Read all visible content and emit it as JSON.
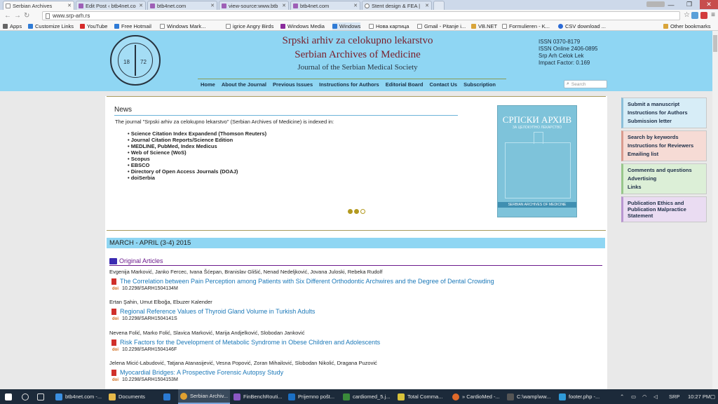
{
  "browser": {
    "tabs": [
      {
        "label": "Serbian Archives",
        "active": true
      },
      {
        "label": "Edit Post ‹ btb4net.co",
        "active": false
      },
      {
        "label": "btb4net.com",
        "active": false
      },
      {
        "label": "view-source:www.btb",
        "active": false
      },
      {
        "label": "btb4net.com",
        "active": false
      },
      {
        "label": "Stent design & FEA |",
        "active": false
      }
    ],
    "profile_label": "",
    "url": "www.srp-arh.rs",
    "bookmarks": [
      "Apps",
      "Customize Links",
      "YouTube",
      "Free Hotmail",
      "Windows Mark...",
      "igrice Angry Birds",
      "Windows Media",
      "Windows",
      "Нова картица",
      "Gmail - Pitanje i...",
      "VB.NET",
      "Formulieren - K...",
      "CSV download ...",
      "Other bookmarks"
    ]
  },
  "site": {
    "logo_year_left": "18",
    "logo_year_right": "72",
    "logo_ring_text": "СРПСКО ЛЕКАРСКО ДРУШТВО",
    "title_serbian": "Srpski arhiv za celokupno lekarstvo",
    "title_english": "Serbian Archives of Medicine",
    "subtitle": "Journal of the Serbian Medical Society",
    "issn": [
      "ISSN 0370-8179",
      "ISSN Online 2406-0895",
      "Srp Arh Celok Lek",
      "Impact Factor: 0.169"
    ],
    "nav": [
      "Home",
      "About the Journal",
      "Previous Issues",
      "Instructions for Authors",
      "Editorial Board",
      "Contact Us",
      "Subscription"
    ],
    "search_placeholder": "Search"
  },
  "news": {
    "title": "News",
    "intro": "The journal \"Srpski arhiv za celokupno lekarstvo\" (Serbian Archives of Medicine) is indexed in:",
    "items": [
      "Science Citation Index Expandend (Thomson Reuters)",
      "Journal Citation Reports/Science Edition",
      "MEDLINE, PubMed, Index Medicus",
      "Web of Science (WoS)",
      "Scopus",
      "EBSCO",
      "Directory of Open Access Journals (DOAJ)",
      "doiSerbia"
    ],
    "cover_title": "СРПСКИ АРХИВ",
    "cover_subtitle": "ЗА ЦЕЛОКУПНО ЛЕКАРСТВО",
    "cover_band": "SERBIAN ARCHIVES OF MEDICINE",
    "carousel": {
      "count": 3,
      "active_index": 2
    }
  },
  "issue": {
    "label": "MARCH - APRIL (3-4) 2015",
    "section": "Original Articles",
    "articles": [
      {
        "authors": "Evgenija Marković, Janko Fercec, Ivana Šćepan, Branislav Glišić, Nenad Nedeljković, Jovana Juloski, Rebeka Rudolf",
        "title": "The Correlation between Pain Perception among Patients with Six Different Orthodontic Archwires and the Degree of Dental Crowding",
        "doi": "10.2298/SARH1504134M"
      },
      {
        "authors": "Ertan Şahin, Umut Elboğa, Ebuzer Kalender",
        "title": "Regional Reference Values of Thyroid Gland Volume in Turkish Adults",
        "doi": "10.2298/SARH1504141S"
      },
      {
        "authors": "Nevena Folić, Marko Folić, Slavica Marković, Marija Andjelković, Slobodan Janković",
        "title": "Risk Factors for the Development of Metabolic Syndrome in Obese Children and Adolescents",
        "doi": "10.2298/SARH1504146F"
      },
      {
        "authors": "Jelena Micić-Labudović, Tatjana Atanasijević, Vesna Popović, Zoran Mihailović, Slobodan Nikolić, Dragana Puzović",
        "title": "Myocardial Bridges: A Prospective Forensic Autopsy Study",
        "doi": "10.2298/SARH1504153M"
      }
    ],
    "doi_logo": "doi"
  },
  "sidebar": {
    "group1": [
      "Submit a manuscript",
      "Instructions for Authors",
      "Submission letter"
    ],
    "group2": [
      "Search by keywords",
      "Instructions for Reviewers",
      "Emailing list"
    ],
    "group3": [
      "Comments and questions",
      "Advertising",
      "Links"
    ],
    "group4": [
      "Publication Ethics and",
      "Publication Malpractice",
      "Statement"
    ]
  },
  "taskbar": {
    "items": [
      "btb4net.com -...",
      "Documents",
      "",
      "Serbian Archiv...",
      "FinBenchRouti...",
      "Prijemno pošt...",
      "cardiomed_5.j...",
      "Total Comma...",
      "» CardioMed -...",
      "C:\\wamp\\ww...",
      "footer.php -..."
    ],
    "lang": "SRP",
    "time": "10:27 PM"
  }
}
